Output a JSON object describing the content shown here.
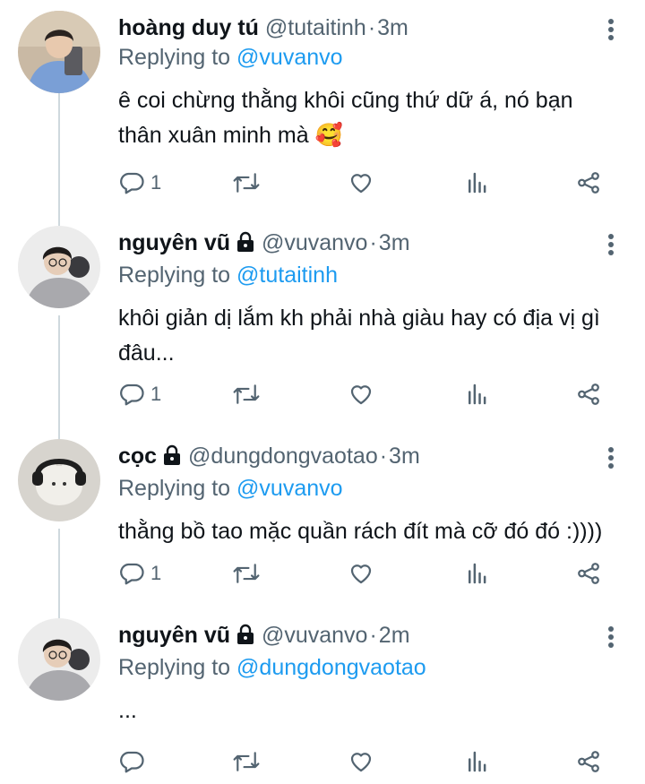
{
  "tweets": [
    {
      "name": "hoàng duy tú",
      "handle": "@tutaitinh",
      "time": "3m",
      "replying_label": "Replying to",
      "replying_to": "@vuvanvo",
      "text": "ê coi chừng thằng khôi cũng thứ dữ á, nó bạn thân xuân minh mà 🥰",
      "locked": false,
      "reply_count": "1"
    },
    {
      "name": "nguyên vũ",
      "handle": "@vuvanvo",
      "time": "3m",
      "replying_label": "Replying to",
      "replying_to": "@tutaitinh",
      "text": "khôi giản dị lắm kh phải nhà giàu hay có địa vị gì đâu...",
      "locked": true,
      "reply_count": "1"
    },
    {
      "name": "cọc",
      "handle": "@dungdongvaotao",
      "time": "3m",
      "replying_label": "Replying to",
      "replying_to": "@vuvanvo",
      "text": "thằng bồ tao mặc quần rách đít mà cỡ đó đó :))))",
      "locked": true,
      "reply_count": "1"
    },
    {
      "name": "nguyên vũ",
      "handle": "@vuvanvo",
      "time": "2m",
      "replying_label": "Replying to",
      "replying_to": "@dungdongvaotao",
      "text": "...",
      "locked": true,
      "reply_count": ""
    }
  ],
  "icons": {
    "reply": "reply-icon",
    "retweet": "retweet-icon",
    "like": "heart-icon",
    "views": "views-icon",
    "share": "share-icon",
    "more": "more-vertical-icon",
    "lock": "lock-icon"
  },
  "colors": {
    "text": "#0f1419",
    "muted": "#536471",
    "accent": "#1d9bf0",
    "thread_line": "#cfd9de"
  }
}
